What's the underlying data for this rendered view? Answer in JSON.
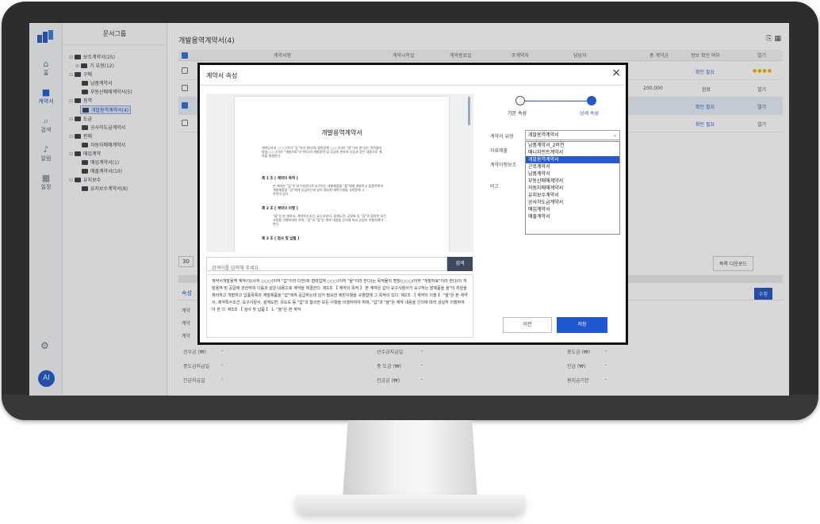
{
  "rail": {
    "items": [
      {
        "label": "홈",
        "icon": "home-icon",
        "glyph": "⌂"
      },
      {
        "label": "계약서",
        "icon": "briefcase-icon",
        "glyph": "■"
      },
      {
        "label": "검색",
        "icon": "search-icon",
        "glyph": "⌕"
      },
      {
        "label": "알림",
        "icon": "bell-icon",
        "glyph": "♪"
      },
      {
        "label": "일정",
        "icon": "calendar-icon",
        "glyph": "▦"
      }
    ],
    "avatar_initial": "AI",
    "accent": "#2459c7"
  },
  "tree": {
    "title": "문서그룹",
    "nodes": [
      {
        "label": "보조계약서(25)"
      },
      {
        "label": "기 유형(12)"
      },
      {
        "label": "구매"
      },
      {
        "label": "납품계약서"
      },
      {
        "label": "부동산매매계약서(5)"
      },
      {
        "label": "용역"
      },
      {
        "label": "개발용역계약서(4)"
      },
      {
        "label": "도급"
      },
      {
        "label": "공사하도급계약서"
      },
      {
        "label": "판매"
      },
      {
        "label": "자동차매매계약서"
      },
      {
        "label": "매입계약"
      },
      {
        "label": "매입계약서(1)"
      },
      {
        "label": "매출계약서(10)"
      },
      {
        "label": "유지보수"
      },
      {
        "label": "유지보수계약서(8)"
      }
    ]
  },
  "main": {
    "title": "개발용역계약서(4)",
    "columns": [
      "계약서명",
      "계약시작일",
      "계약종료일",
      "주계약자",
      "담당자",
      "총 계약금",
      "정보 확인 여부",
      "열기"
    ],
    "rows": [
      {
        "amount": "",
        "status": "확인 필요",
        "open": ""
      },
      {
        "amount": "200,000",
        "status": "완료",
        "open": "열기"
      },
      {
        "amount": "",
        "status": "확인 필요",
        "open": "열기"
      },
      {
        "amount": "",
        "status": "확인 필요",
        "open": "열기"
      }
    ],
    "page_size": "30",
    "download_label": "목록 다운로드",
    "detail_tab": "속성",
    "edit_label": "수정",
    "detail_fields": [
      {
        "label": "계약",
        "value": ""
      },
      {
        "label": "계약",
        "value": ""
      },
      {
        "label": "계약",
        "value": ""
      },
      {
        "label": "선수금 (₩)",
        "value": "-"
      },
      {
        "label": "중도금지급일",
        "value": "-"
      },
      {
        "label": "잔금지급일",
        "value": "-"
      },
      {
        "label": "선수금지급일",
        "value": "-"
      },
      {
        "label": "중 도금 (₩)",
        "value": "-"
      },
      {
        "label": "잔금금 (₩)",
        "value": "-"
      },
      {
        "label": "중도금 (₩)",
        "value": "-"
      },
      {
        "label": "잔금 (₩)",
        "value": "-"
      },
      {
        "label": "원지급기한",
        "value": "-"
      }
    ]
  },
  "modal": {
    "title": "계약서 속성",
    "steps": [
      "기본 속성",
      "상세 속성"
    ],
    "preview": {
      "doc_title": "개발용역계약서",
      "sections": [
        "제 1 조 [ 계약의 목적 ]",
        "제 2 조 [ 계약의 이행 ]",
        "제 3 조 [ 검사 및 납품 ]"
      ]
    },
    "search_placeholder": "검색어를 입력해 주세요.",
    "search_label": "검색",
    "body_text": "계약서개발용역 계약(이)사자 ○○○(이하 \"갑\"이라 다한)와 협력업체 ○○○(이하 \"을\"이라 한다)는 목적물의 명칭(○○○(이하 \"개발자료\"이라 한다)의 개발용역 및 공급에 관한하여 다음과 같은 내용으로 계약을 체결한다. 제1조 【 계약의 목적 】 본 계약은 갑이 요구사항서가 요구하는 발제품을 을\"이 자원을 제어하고 개발하고 납품목록과 계발제품을 \"갑\"에게 공급하는데 있어 필요한 제반사항을 규정함에 그 목적이 있다. 제2조 【 계약의 이행 】 \"을\"은 본 계약서, 제약특수조건, 요구사양서, 설계도면, 유도도 등 \"갑\"과 합의한 모든 사항을 이행하여야 하며, \"갑\"과 \"을\"은 계약 내용을 신의에 따라 성실히 이행하여야 한 다. 제3조 【 검사 및 납품 】 1. \"을\"은 본 계약",
    "fields": {
      "type_label": "계약서 유형",
      "type_value": "개발용역계약서",
      "label_2": "자료제출",
      "label_3": "계약이행보조",
      "label_4": "비고"
    },
    "options": [
      "납품계약서_2버전",
      "매니지먼트계약서",
      "개발용역계약서",
      "근로계약서",
      "납품계약서",
      "부동산매매계약서",
      "자동차매매계약서",
      "유지보수계약서",
      "공사하도급계약서",
      "매입계약서",
      "매출계약서"
    ],
    "selected_option": "개발용역계약서",
    "prev_label": "이전",
    "save_label": "저장"
  }
}
